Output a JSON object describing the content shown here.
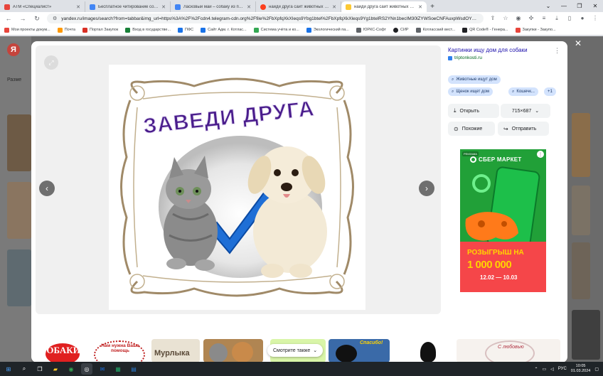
{
  "browser": {
    "tabs": [
      {
        "title": "АТМ «Специалист»",
        "color": "#e8453c",
        "active": false
      },
      {
        "title": "Бесплатное читирование собак",
        "color": "#4285f4",
        "active": false
      },
      {
        "title": "Ласковый май – собаку из приют",
        "color": "#4285f4",
        "active": false
      },
      {
        "title": "найди друга сайт животных соб",
        "color": "#fc3f1d",
        "active": false
      },
      {
        "title": "найди друга сайт животных соб",
        "color": "#fcc934",
        "active": true
      }
    ],
    "url": "yandex.ru/images/search?from=tabbar&img_url=https%3A%2F%2Fcdn4.telegram-cdn.org%2Ffile%2FbXpfqXkXIeqs9Ybg1btel%2FbXpfqXkXleqs9Yg1btelRS2YNn1becIM30lZYWSoeCNFAuxpWsdOYXKQqftNGYFUX1RTH...",
    "bookmarks": [
      {
        "label": "Мои проекты докум...",
        "color": "#e8453c"
      },
      {
        "label": "Почта",
        "color": "#ff9900"
      },
      {
        "label": "Портал Закупок",
        "color": "#d93025"
      },
      {
        "label": "Вход в государстве...",
        "color": "#188038"
      },
      {
        "label": "ПФС",
        "color": "#1a73e8"
      },
      {
        "label": "Сайт Адм. г. Котлас...",
        "color": "#1a73e8"
      },
      {
        "label": "Система учёта и ко...",
        "color": "#34a853"
      },
      {
        "label": "Экологический па...",
        "color": "#1a73e8"
      },
      {
        "label": "ЮРКС-Софт",
        "color": "#5f6368"
      },
      {
        "label": "СИР",
        "color": "#202124"
      },
      {
        "label": "Котласский вест...",
        "color": "#5f6368"
      },
      {
        "label": "QR Code® - Генера...",
        "color": "#202124"
      },
      {
        "label": "Закупки - Закупо...",
        "color": "#e8453c"
      }
    ]
  },
  "page": {
    "logo": "Я",
    "size_label": "Разме"
  },
  "viewer": {
    "image_caption": "ЗАВЕДИ ДРУГА"
  },
  "info": {
    "title": "Картинки ищу дом для собаки",
    "source": "triptonkosti.ru",
    "tags": [
      "Животные ищут дом",
      "Щенок ищет дом",
      "Кошечк...",
      "+1"
    ],
    "open_label": "Открыть",
    "dimensions": "715×687",
    "similar_label": "Похожие",
    "share_label": "Отправить"
  },
  "ad": {
    "badge": "РЕКЛАМА",
    "brand": "СБЕР МАРКЕТ",
    "promo_line1": "РОЗЫГРЫШ НА",
    "promo_line2": "1 000 000",
    "dates": "12.02 — 10.03"
  },
  "strip": {
    "more_label": "Смотрите также",
    "thumb1": "СОБАКИ",
    "thumb2": "Нам нужна Ваша помощь",
    "thumb3": "Мурлыка",
    "thumb4": "Спасибо!",
    "thumb5": "С любовью"
  },
  "taskbar": {
    "lang": "РУС",
    "time": "10:05",
    "date": "01.03.2024"
  }
}
